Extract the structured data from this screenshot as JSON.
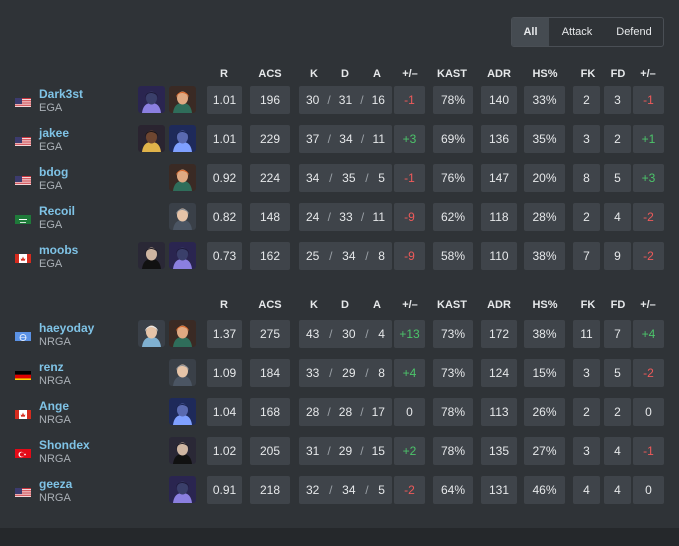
{
  "filters": [
    {
      "label": "All",
      "active": true
    },
    {
      "label": "Attack",
      "active": false
    },
    {
      "label": "Defend",
      "active": false
    }
  ],
  "columns": [
    "R",
    "ACS",
    "K",
    "D",
    "A",
    "+/–",
    "KAST",
    "ADR",
    "HS%",
    "FK",
    "FD",
    "+/–"
  ],
  "colors": {
    "positive": "#4cc46a",
    "negative": "#ef5a5a",
    "name": "#7fc3e6"
  },
  "teams": [
    {
      "players": [
        {
          "name": "Dark3st",
          "team": "EGA",
          "flag": "us",
          "agents": [
            "agent-purple-hooded",
            "agent-orange-hair"
          ],
          "r": "1.01",
          "acs": "196",
          "k": "30",
          "d": "31",
          "a": "16",
          "kd_diff": "-1",
          "kast": "78%",
          "adr": "140",
          "hs": "33%",
          "fk": "2",
          "fd": "3",
          "fk_diff": "-1"
        },
        {
          "name": "jakee",
          "team": "EGA",
          "flag": "us",
          "agents": [
            "agent-dark-brown",
            "agent-blue-hooded"
          ],
          "r": "1.01",
          "acs": "229",
          "k": "37",
          "d": "34",
          "a": "11",
          "kd_diff": "+3",
          "kast": "69%",
          "adr": "136",
          "hs": "35%",
          "fk": "3",
          "fd": "2",
          "fk_diff": "+1"
        },
        {
          "name": "bdog",
          "team": "EGA",
          "flag": "us",
          "agents": [
            "agent-orange-hair"
          ],
          "r": "0.92",
          "acs": "224",
          "k": "34",
          "d": "35",
          "a": "5",
          "kd_diff": "-1",
          "kast": "76%",
          "adr": "147",
          "hs": "20%",
          "fk": "8",
          "fd": "5",
          "fk_diff": "+3"
        },
        {
          "name": "Recoil",
          "team": "EGA",
          "flag": "sa",
          "agents": [
            "agent-grey-hair"
          ],
          "r": "0.82",
          "acs": "148",
          "k": "24",
          "d": "33",
          "a": "11",
          "kd_diff": "-9",
          "kast": "62%",
          "adr": "118",
          "hs": "28%",
          "fk": "2",
          "fd": "4",
          "fk_diff": "-2"
        },
        {
          "name": "moobs",
          "team": "EGA",
          "flag": "ca",
          "agents": [
            "agent-masked",
            "agent-purple-hooded"
          ],
          "r": "0.73",
          "acs": "162",
          "k": "25",
          "d": "34",
          "a": "8",
          "kd_diff": "-9",
          "kast": "58%",
          "adr": "110",
          "hs": "38%",
          "fk": "7",
          "fd": "9",
          "fk_diff": "-2"
        }
      ]
    },
    {
      "players": [
        {
          "name": "haeyoday",
          "team": "NRGA",
          "flag": "un",
          "agents": [
            "agent-white-hair",
            "agent-orange-hair"
          ],
          "r": "1.37",
          "acs": "275",
          "k": "43",
          "d": "30",
          "a": "4",
          "kd_diff": "+13",
          "kast": "73%",
          "adr": "172",
          "hs": "38%",
          "fk": "11",
          "fd": "7",
          "fk_diff": "+4"
        },
        {
          "name": "renz",
          "team": "NRGA",
          "flag": "de",
          "agents": [
            "agent-grey-hair"
          ],
          "r": "1.09",
          "acs": "184",
          "k": "33",
          "d": "29",
          "a": "8",
          "kd_diff": "+4",
          "kast": "73%",
          "adr": "124",
          "hs": "15%",
          "fk": "3",
          "fd": "5",
          "fk_diff": "-2"
        },
        {
          "name": "Ange",
          "team": "NRGA",
          "flag": "ca",
          "agents": [
            "agent-blue-hooded"
          ],
          "r": "1.04",
          "acs": "168",
          "k": "28",
          "d": "28",
          "a": "17",
          "kd_diff": "0",
          "kast": "78%",
          "adr": "113",
          "hs": "26%",
          "fk": "2",
          "fd": "2",
          "fk_diff": "0"
        },
        {
          "name": "Shondex",
          "team": "NRGA",
          "flag": "tr",
          "agents": [
            "agent-masked"
          ],
          "r": "1.02",
          "acs": "205",
          "k": "31",
          "d": "29",
          "a": "15",
          "kd_diff": "+2",
          "kast": "78%",
          "adr": "135",
          "hs": "27%",
          "fk": "3",
          "fd": "4",
          "fk_diff": "-1"
        },
        {
          "name": "geeza",
          "team": "NRGA",
          "flag": "us",
          "agents": [
            "agent-purple-hooded"
          ],
          "r": "0.91",
          "acs": "218",
          "k": "32",
          "d": "34",
          "a": "5",
          "kd_diff": "-2",
          "kast": "64%",
          "adr": "131",
          "hs": "46%",
          "fk": "4",
          "fd": "4",
          "fk_diff": "0"
        }
      ]
    }
  ]
}
